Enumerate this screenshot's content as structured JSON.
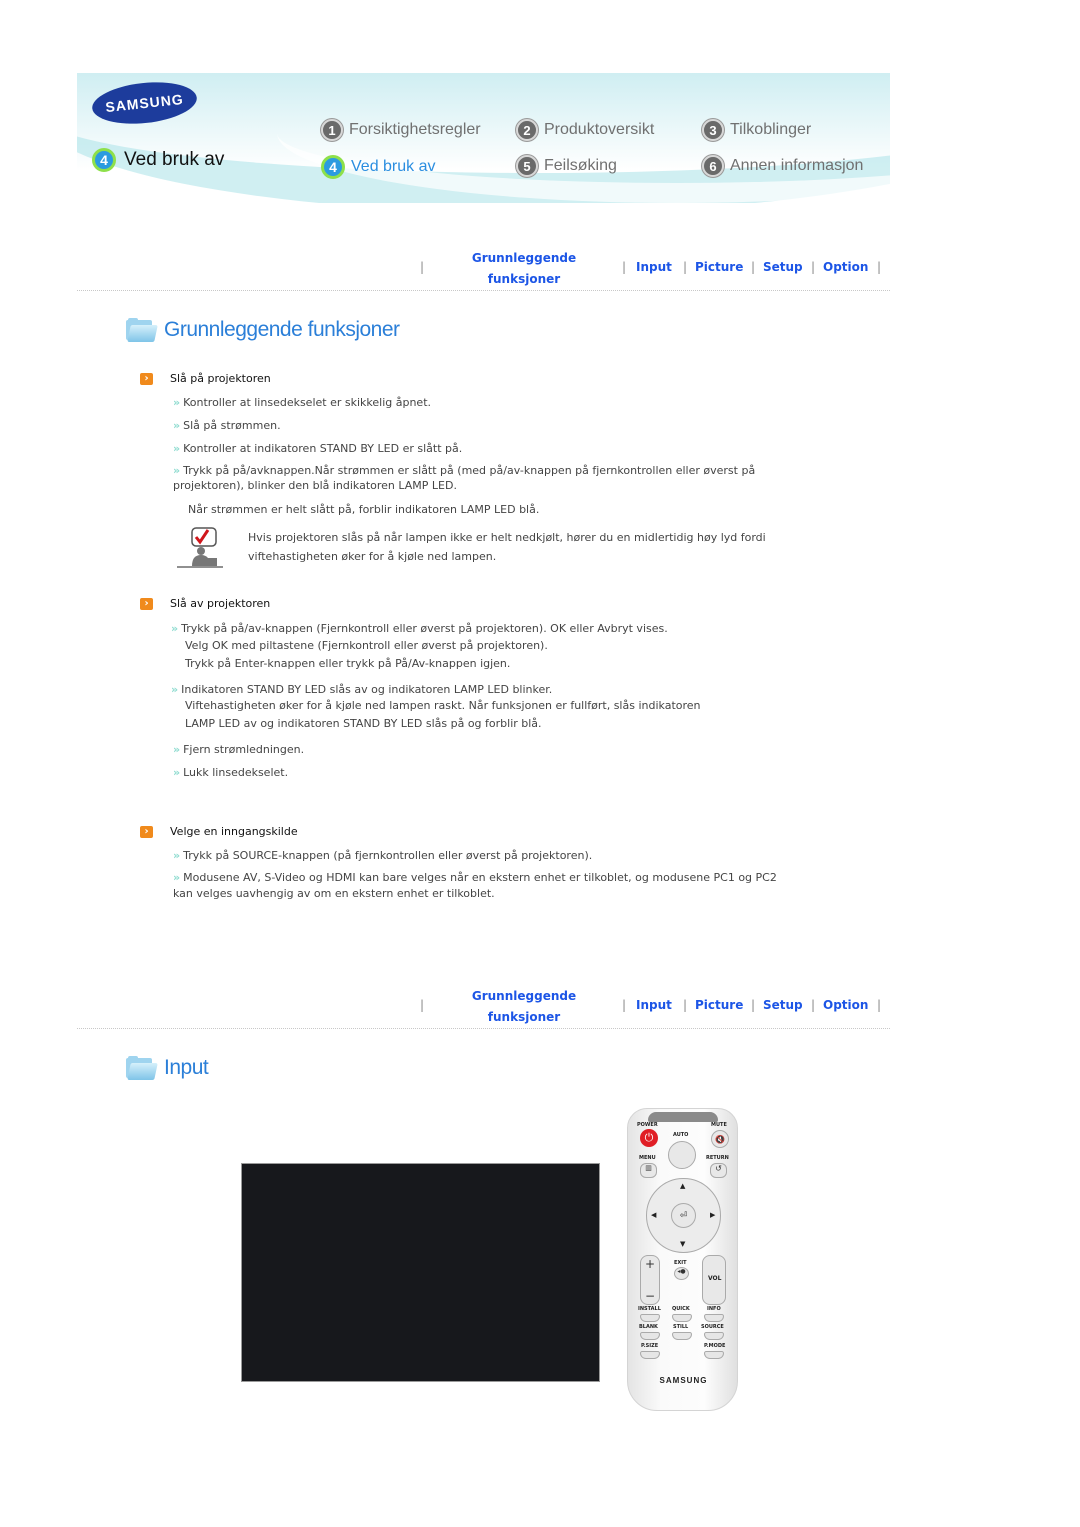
{
  "header": {
    "brand": "SAMSUNG",
    "current_section": {
      "number": "4",
      "label": "Ved bruk av"
    },
    "nav": [
      {
        "number": "1",
        "label": "Forsiktighetsregler",
        "active": false
      },
      {
        "number": "2",
        "label": "Produktoversikt",
        "active": false
      },
      {
        "number": "3",
        "label": "Tilkoblinger",
        "active": false
      },
      {
        "number": "4",
        "label": "Ved bruk av",
        "active": true
      },
      {
        "number": "5",
        "label": "Feilsøking",
        "active": false
      },
      {
        "number": "6",
        "label": "Annen informasjon",
        "active": false
      }
    ]
  },
  "subnav": {
    "basic_line1": "Grunnleggende",
    "basic_line2": "funksjoner",
    "input": "Input",
    "picture": "Picture",
    "setup": "Setup",
    "option": "Option",
    "separator": "|"
  },
  "section1": {
    "title": "Grunnleggende funksjoner",
    "topics": [
      {
        "title": "Slå på projektoren",
        "items": [
          "Kontroller at linsedekselet er skikkelig åpnet.",
          "Slå på strømmen.",
          "Kontroller at indikatoren STAND BY LED er slått på.",
          "Trykk på på/avknappen.Når strømmen er slått på (med på/av-knappen på fjernkontrollen eller øverst på",
          "projektoren), blinker den blå indikatoren LAMP LED.",
          "Når strømmen er helt slått på, forblir indikatoren LAMP LED blå."
        ],
        "note_line1": "Hvis projektoren slås på når lampen ikke er helt nedkjølt, hører du en midlertidig høy lyd fordi",
        "note_line2": "viftehastigheten øker for å kjøle ned lampen."
      },
      {
        "title": "Slå av projektoren",
        "items": [
          "Trykk på på/av-knappen (Fjernkontroll eller øverst på projektoren). OK eller Avbryt vises.",
          "Velg OK med piltastene (Fjernkontroll eller øverst på projektoren).",
          "Trykk på Enter-knappen eller trykk på På/Av-knappen igjen.",
          "Indikatoren STAND BY LED slås av og indikatoren LAMP LED blinker.",
          "Viftehastigheten øker for å kjøle ned lampen raskt. Når funksjonen er fullført, slås indikatoren",
          "LAMP LED av og indikatoren STAND BY LED slås på og forblir blå.",
          "Fjern strømledningen.",
          "Lukk linsedekselet."
        ]
      },
      {
        "title": "Velge en inngangskilde",
        "items": [
          "Trykk på SOURCE-knappen (på fjernkontrollen eller øverst på projektoren).",
          "Modusene AV, S-Video og HDMI kan bare velges når en ekstern enhet er tilkoblet, og modusene PC1 og PC2",
          "kan velges uavhengig av om en ekstern enhet er tilkoblet."
        ]
      }
    ]
  },
  "section2": {
    "title": "Input"
  },
  "remote": {
    "labels": {
      "power": "POWER",
      "mute": "MUTE",
      "auto": "AUTO",
      "menu": "MENU",
      "return": "RETURN",
      "exit": "EXIT",
      "vol": "VOL",
      "install": "INSTALL",
      "quick": "QUICK",
      "info": "INFO",
      "blank": "BLANK",
      "still": "STILL",
      "source": "SOURCE",
      "psize": "P.SIZE",
      "pmode": "P.MODE",
      "brand": "SAMSUNG"
    }
  },
  "colors": {
    "link": "#1c55e6",
    "heading": "#2b7fd8",
    "bullet": "#f08a1c",
    "power_button": "#e01e25"
  }
}
